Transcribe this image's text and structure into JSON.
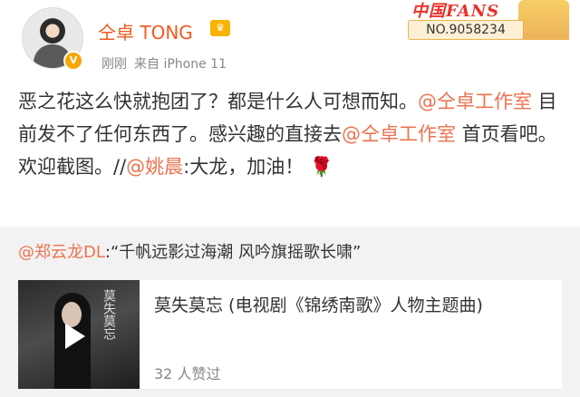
{
  "user": {
    "name": "仝卓 TONG",
    "time": "刚刚",
    "source": "来自 iPhone 11"
  },
  "badge": {
    "fans_logo": "中国FANS",
    "fans_number": "NO.9058234"
  },
  "post": {
    "line1": "恶之花这么快就抱团了？都是什么人可想而知。",
    "mention1": "@仝卓工作室",
    "line2": " 目前发不了任何东西了。感兴趣的直接去",
    "mention2": "@仝卓工作室",
    "line3": " 首页看吧。欢迎截图。//",
    "mention3": "@姚晨",
    "line4": ":大龙，加油！",
    "rose": "🌹"
  },
  "repost": {
    "author": "@郑云龙DL",
    "text": ":“千帆远影过海潮  风吟旗摇歌长啸”"
  },
  "card": {
    "title": "莫失莫忘 (电视剧《锦绣南歌》人物主题曲)",
    "likes": "32 人赞过",
    "thumb_text": "莫失莫忘"
  },
  "colors": {
    "mention": "#eb7350",
    "username": "#f05a20"
  }
}
